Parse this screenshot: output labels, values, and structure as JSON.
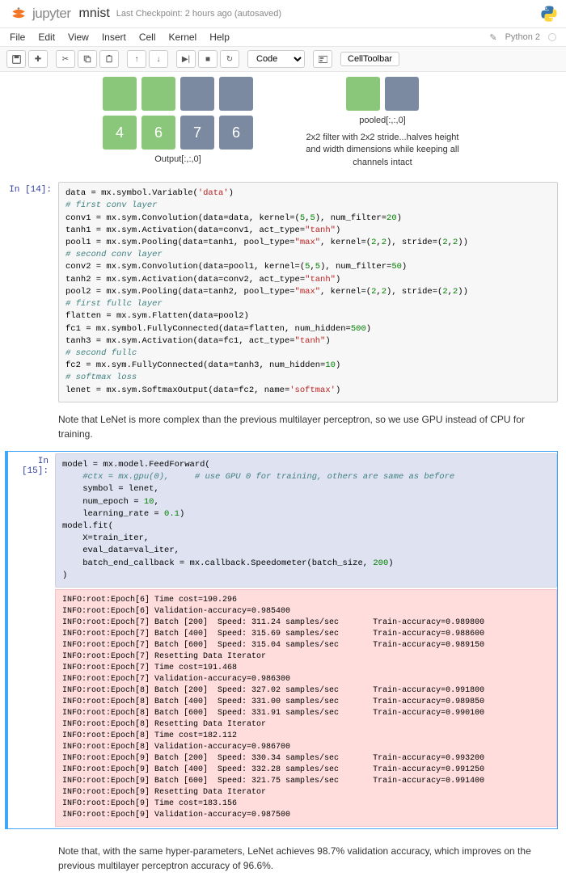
{
  "header": {
    "title": "mnist",
    "checkpoint": "Last Checkpoint: 2 hours ago (autosaved)",
    "kernel": "Python 2"
  },
  "menu": {
    "items": [
      "File",
      "Edit",
      "View",
      "Insert",
      "Cell",
      "Kernel",
      "Help"
    ]
  },
  "toolbar": {
    "celltype": "Code",
    "celltoolbar": "CellToolbar"
  },
  "diagram": {
    "output_label": "Output[:,:,0]",
    "pooled_label": "pooled[:,:,0]",
    "tiles_row1": [
      "",
      "",
      "",
      ""
    ],
    "tiles_row2": [
      "4",
      "6",
      "7",
      "6"
    ],
    "right_text": "2x2 filter with 2x2 stride...halves height and width dimensions while keeping all channels intact"
  },
  "cells": {
    "c14": {
      "prompt": "In [14]:",
      "code": "data = mx.symbol.Variable('data')\n# first conv layer\nconv1 = mx.sym.Convolution(data=data, kernel=(5,5), num_filter=20)\ntanh1 = mx.sym.Activation(data=conv1, act_type=\"tanh\")\npool1 = mx.sym.Pooling(data=tanh1, pool_type=\"max\", kernel=(2,2), stride=(2,2))\n# second conv layer\nconv2 = mx.sym.Convolution(data=pool1, kernel=(5,5), num_filter=50)\ntanh2 = mx.sym.Activation(data=conv2, act_type=\"tanh\")\npool2 = mx.sym.Pooling(data=tanh2, pool_type=\"max\", kernel=(2,2), stride=(2,2))\n# first fullc layer\nflatten = mx.sym.Flatten(data=pool2)\nfc1 = mx.symbol.FullyConnected(data=flatten, num_hidden=500)\ntanh3 = mx.sym.Activation(data=fc1, act_type=\"tanh\")\n# second fullc\nfc2 = mx.sym.FullyConnected(data=tanh3, num_hidden=10)\n# softmax loss\nlenet = mx.sym.SoftmaxOutput(data=fc2, name='softmax')"
    },
    "md1": {
      "text": "Note that LeNet is more complex than the previous multilayer perceptron, so we use GPU instead of CPU for training."
    },
    "c15": {
      "prompt": "In [15]:",
      "code": "model = mx.model.FeedForward(\n    #ctx = mx.gpu(0),     # use GPU 0 for training, others are same as before\n    symbol = lenet,\n    num_epoch = 10,\n    learning_rate = 0.1)\nmodel.fit(\n    X=train_iter,\n    eval_data=val_iter,\n    batch_end_callback = mx.callback.Speedometer(batch_size, 200)\n)",
      "output": "INFO:root:Epoch[6] Time cost=190.296\nINFO:root:Epoch[6] Validation-accuracy=0.985400\nINFO:root:Epoch[7] Batch [200]  Speed: 311.24 samples/sec       Train-accuracy=0.989800\nINFO:root:Epoch[7] Batch [400]  Speed: 315.69 samples/sec       Train-accuracy=0.988600\nINFO:root:Epoch[7] Batch [600]  Speed: 315.04 samples/sec       Train-accuracy=0.989150\nINFO:root:Epoch[7] Resetting Data Iterator\nINFO:root:Epoch[7] Time cost=191.468\nINFO:root:Epoch[7] Validation-accuracy=0.986300\nINFO:root:Epoch[8] Batch [200]  Speed: 327.02 samples/sec       Train-accuracy=0.991800\nINFO:root:Epoch[8] Batch [400]  Speed: 331.00 samples/sec       Train-accuracy=0.989850\nINFO:root:Epoch[8] Batch [600]  Speed: 331.91 samples/sec       Train-accuracy=0.990100\nINFO:root:Epoch[8] Resetting Data Iterator\nINFO:root:Epoch[8] Time cost=182.112\nINFO:root:Epoch[8] Validation-accuracy=0.986700\nINFO:root:Epoch[9] Batch [200]  Speed: 330.34 samples/sec       Train-accuracy=0.993200\nINFO:root:Epoch[9] Batch [400]  Speed: 332.28 samples/sec       Train-accuracy=0.991250\nINFO:root:Epoch[9] Batch [600]  Speed: 321.75 samples/sec       Train-accuracy=0.991400\nINFO:root:Epoch[9] Resetting Data Iterator\nINFO:root:Epoch[9] Time cost=183.156\nINFO:root:Epoch[9] Validation-accuracy=0.987500"
    },
    "after": {
      "text": "Note that, with the same hyper-parameters, LeNet achieves 98.7% validation accuracy, which improves on the previous multilayer perceptron accuracy of 96.6%."
    }
  }
}
